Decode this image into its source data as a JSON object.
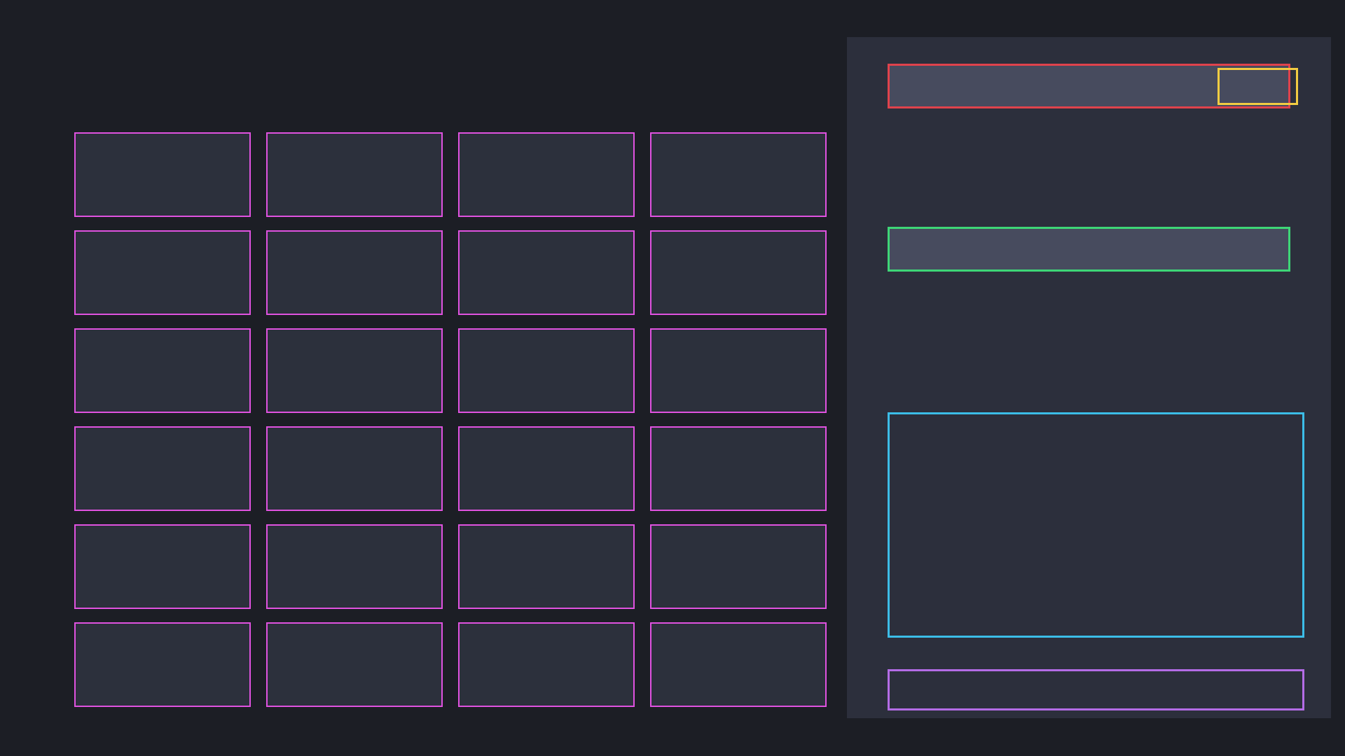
{
  "tiles": [
    {
      "label": ""
    },
    {
      "label": ""
    },
    {
      "label": ""
    },
    {
      "label": ""
    },
    {
      "label": ""
    },
    {
      "label": ""
    },
    {
      "label": ""
    },
    {
      "label": ""
    },
    {
      "label": ""
    },
    {
      "label": ""
    },
    {
      "label": ""
    },
    {
      "label": ""
    },
    {
      "label": ""
    },
    {
      "label": ""
    },
    {
      "label": ""
    },
    {
      "label": ""
    },
    {
      "label": ""
    },
    {
      "label": ""
    },
    {
      "label": ""
    },
    {
      "label": ""
    },
    {
      "label": ""
    },
    {
      "label": ""
    },
    {
      "label": ""
    },
    {
      "label": ""
    }
  ],
  "panel": {
    "top_input": {
      "value": ""
    },
    "top_input_button": {
      "label": ""
    },
    "second_input": {
      "value": ""
    },
    "content_area": {
      "text": ""
    },
    "bottom_bar": {
      "label": ""
    }
  },
  "colors": {
    "background": "#1c1e25",
    "tile_fill": "#2c303c",
    "tile_border": "#e052e0",
    "panel_fill": "#2c2f3c",
    "input_fill": "#474b5e",
    "red_outline": "#e0424c",
    "yellow_outline": "#f2cc42",
    "green_outline": "#3ed677",
    "blue_outline": "#3cbde8",
    "purple_outline": "#b46ce6"
  }
}
